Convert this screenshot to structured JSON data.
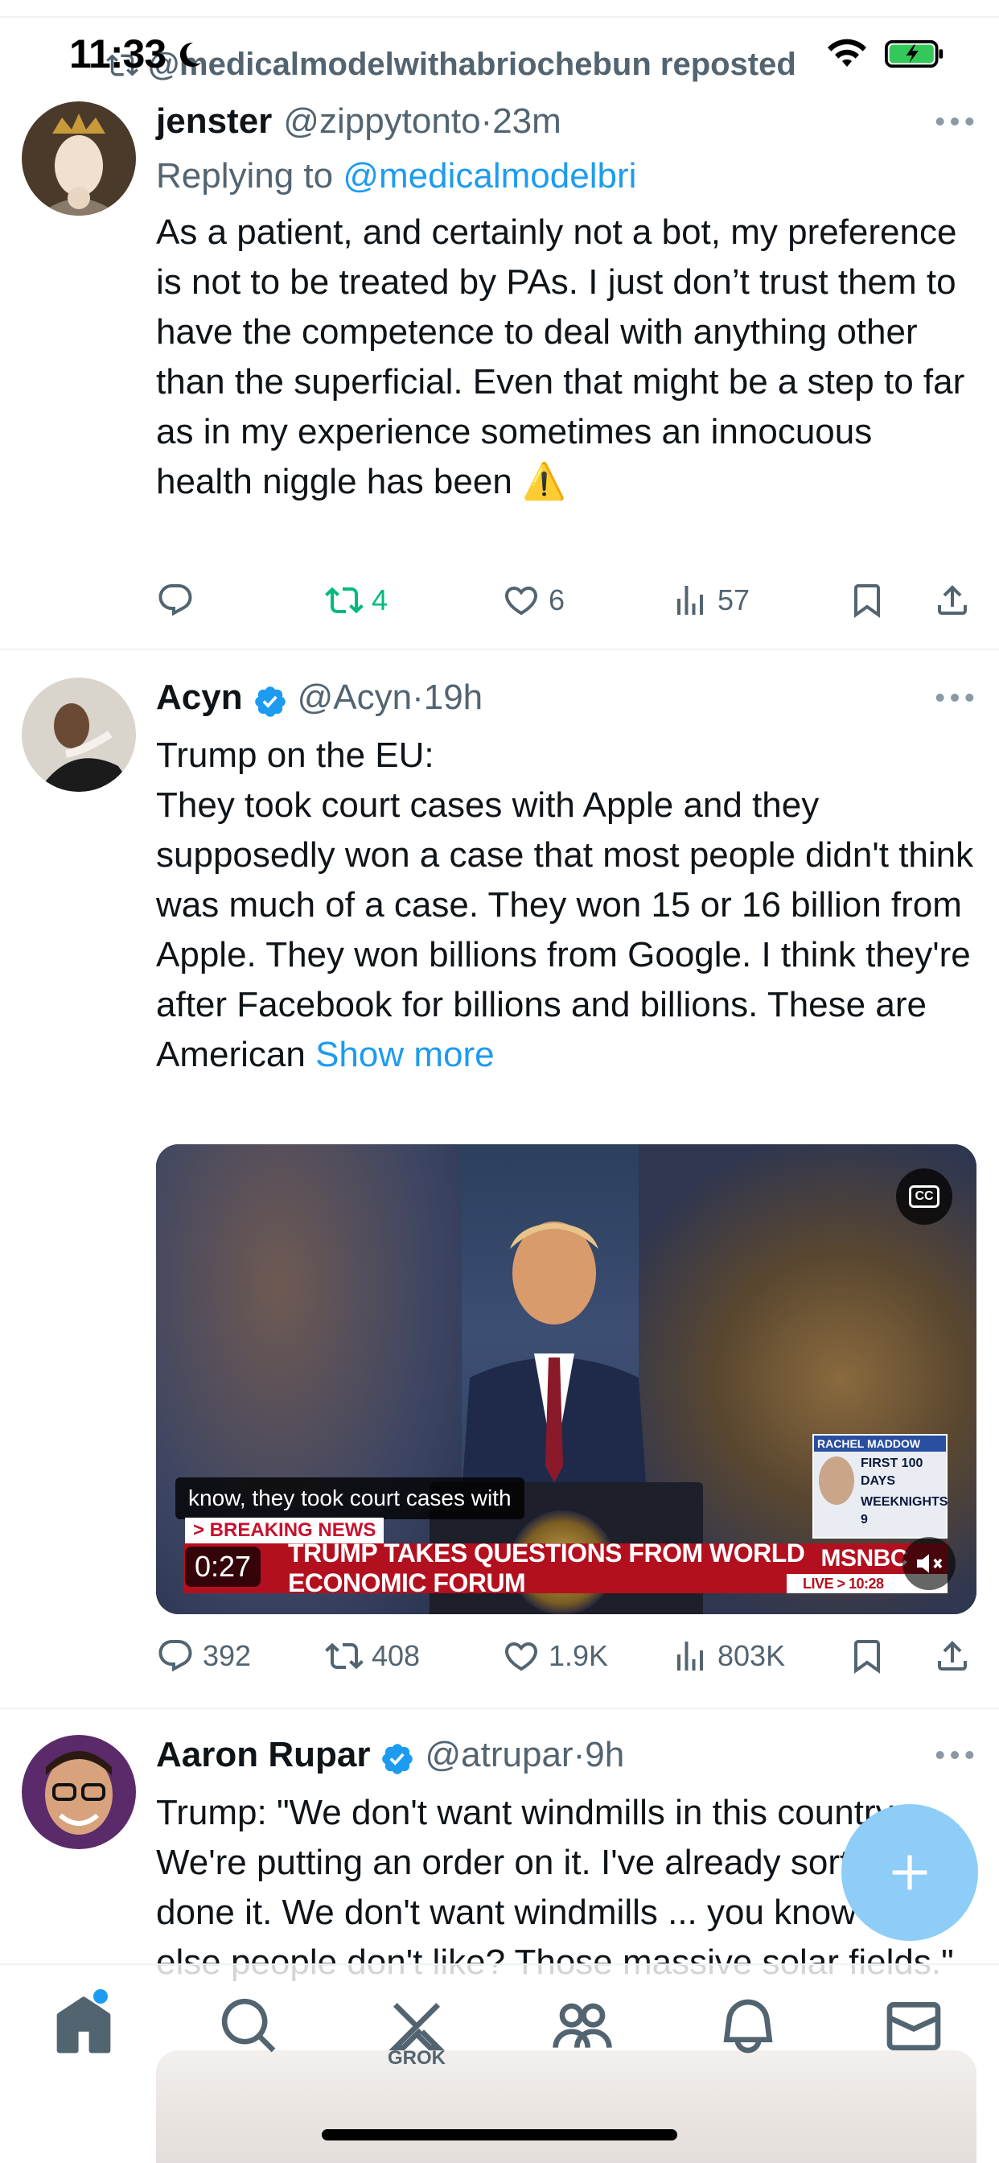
{
  "status_bar": {
    "time": "11:33"
  },
  "repost": {
    "text": "@medicalmodelwithabriochebun reposted"
  },
  "tweets": [
    {
      "display_name": "jenster",
      "handle": "@zippytonto",
      "separator": "·",
      "time": "23m",
      "replying_prefix": "Replying to ",
      "replying_to": "@medicalmodelbri",
      "text": "As a patient, and certainly not a bot, my preference is not to be treated by PAs. I just don’t trust them to have the competence to deal with anything other than the superficial. Even that might be a step to far as in my experience sometimes an innocuous health niggle has been ⚠️",
      "actions": {
        "reply": "",
        "retweet": "4",
        "like": "6",
        "views": "57"
      }
    },
    {
      "display_name": "Acyn",
      "handle": "@Acyn",
      "separator": "·",
      "time": "19h",
      "verified": true,
      "text": "Trump on the EU:\nThey took court cases with Apple and they supposedly won a case that most people didn't think was much of a case. They won 15 or 16 billion from Apple. They won billions from Google. I think they're after Facebook for billions and billions. These are American ",
      "show_more": "Show more",
      "media": {
        "caption": "know, they took court cases with",
        "breaking_label": "> BREAKING NEWS",
        "chyron": "TRUMP TAKES QUESTIONS FROM WORLD ECONOMIC FORUM",
        "network": "MSNBC",
        "live_label": "LIVE > 10:28",
        "duration": "0:27",
        "cc_label": "CC",
        "promo_title": "RACHEL MADDOW",
        "promo_line1": "FIRST 100 DAYS",
        "promo_line2": "WEEKNIGHTS 9"
      },
      "actions": {
        "reply": "392",
        "retweet": "408",
        "like": "1.9K",
        "views": "803K"
      }
    },
    {
      "display_name": "Aaron Rupar",
      "handle": "@atrupar",
      "separator": "·",
      "time": "9h",
      "verified": true,
      "text": "Trump: \"We don't want windmills in this country. We're putting an order on it. I've already sort of done it. We don't want windmills ... you know what else people don't like? Those massive solar fields.\""
    }
  ],
  "tab_bar": {
    "grok_label": "GROK"
  },
  "colors": {
    "accent": "#1d9bf0",
    "retweet_green": "#00ba7c",
    "secondary_text": "#536471",
    "chyron_red": "#b3101f"
  },
  "icons": [
    "moon-icon",
    "wifi-icon",
    "battery-icon",
    "repost-icon",
    "more-icon",
    "verified-icon",
    "reply-icon",
    "retweet-icon",
    "like-icon",
    "views-icon",
    "bookmark-icon",
    "share-icon",
    "mute-icon",
    "compose-icon",
    "home-icon",
    "search-icon",
    "grok-icon",
    "communities-icon",
    "notifications-icon",
    "messages-icon"
  ]
}
